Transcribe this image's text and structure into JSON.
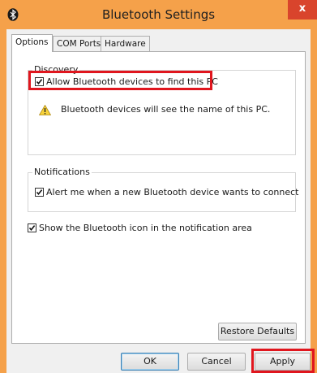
{
  "window": {
    "title": "Bluetooth Settings",
    "close_glyph": "x",
    "app_icon": "bluetooth-icon"
  },
  "tabs": [
    {
      "label": "Options",
      "active": true
    },
    {
      "label": "COM Ports",
      "active": false
    },
    {
      "label": "Hardware",
      "active": false
    }
  ],
  "discovery": {
    "title": "Discovery",
    "allow_label": "Allow Bluetooth devices to find this PC",
    "allow_checked": true,
    "warning_text": "Bluetooth devices will see the name of this PC.",
    "warning_icon": "warning-icon"
  },
  "notifications": {
    "title": "Notifications",
    "alert_label": "Alert me when a new Bluetooth device wants to connect",
    "alert_checked": true
  },
  "show_icon": {
    "label": "Show the Bluetooth icon in the notification area",
    "checked": true
  },
  "buttons": {
    "restore": "Restore Defaults",
    "ok": "OK",
    "cancel": "Cancel",
    "apply": "Apply"
  },
  "colors": {
    "titlebar": "#f5a14a",
    "close": "#d9442c",
    "highlight": "#e0161e"
  }
}
